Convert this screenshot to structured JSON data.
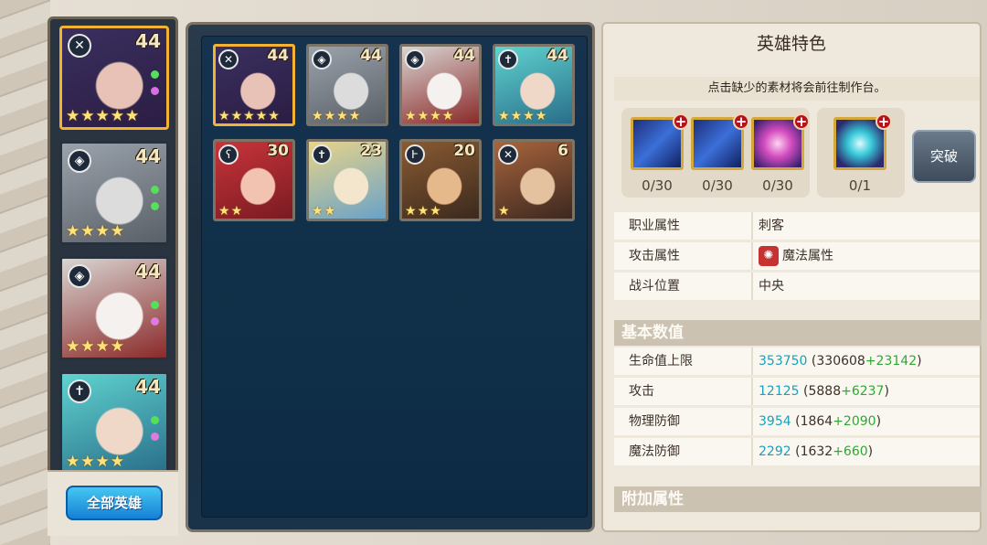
{
  "left_list": {
    "heroes": [
      {
        "level": "44",
        "stars": 5,
        "class_icon": "assassin-icon",
        "selected": true,
        "palette": [
          "#3a2f5e",
          "#e8c2b6",
          "#2b1d44"
        ],
        "gems": [
          "#55e05a",
          "#d86fe0"
        ]
      },
      {
        "level": "44",
        "stars": 4,
        "class_icon": "shield-icon",
        "selected": false,
        "palette": [
          "#9aa2ab",
          "#dcdcdc",
          "#5a6068"
        ],
        "gems": [
          "#55e05a",
          "#55e05a"
        ]
      },
      {
        "level": "44",
        "stars": 4,
        "class_icon": "shield-icon",
        "selected": false,
        "palette": [
          "#d8d5d2",
          "#f4f1ee",
          "#8b2a2a"
        ],
        "gems": [
          "#55e05a",
          "#e07ae0"
        ]
      },
      {
        "level": "44",
        "stars": 4,
        "class_icon": "cross-icon",
        "selected": false,
        "palette": [
          "#5fd3cf",
          "#f0d8c8",
          "#2a6e8a"
        ],
        "gems": [
          "#55e05a",
          "#e07ae0"
        ]
      }
    ],
    "all_heroes_label": "全部英雄"
  },
  "grid": {
    "heroes": [
      {
        "level": "44",
        "stars": 5,
        "class_icon": "assassin-icon",
        "selected": true,
        "palette": [
          "#3a2f5e",
          "#e8c2b6",
          "#2b1d44"
        ]
      },
      {
        "level": "44",
        "stars": 4,
        "class_icon": "shield-icon",
        "selected": false,
        "palette": [
          "#9aa2ab",
          "#dcdcdc",
          "#5a6068"
        ]
      },
      {
        "level": "44",
        "stars": 4,
        "class_icon": "shield-icon",
        "selected": false,
        "palette": [
          "#d8d5d2",
          "#f4f1ee",
          "#8b2a2a"
        ]
      },
      {
        "level": "44",
        "stars": 4,
        "class_icon": "cross-icon",
        "selected": false,
        "palette": [
          "#5fd3cf",
          "#f0d8c8",
          "#2a6e8a"
        ]
      },
      {
        "level": "30",
        "stars": 2,
        "class_icon": "staff-icon",
        "selected": false,
        "palette": [
          "#c8343a",
          "#f2c3b0",
          "#7a1b22"
        ]
      },
      {
        "level": "23",
        "stars": 2,
        "class_icon": "cross-icon",
        "selected": false,
        "palette": [
          "#e8d488",
          "#f4e6cc",
          "#6aa2c8"
        ]
      },
      {
        "level": "20",
        "stars": 3,
        "class_icon": "axe-icon",
        "selected": false,
        "palette": [
          "#8a5a32",
          "#e6b98c",
          "#3b2a1e"
        ]
      },
      {
        "level": "6",
        "stars": 1,
        "class_icon": "assassin-icon",
        "selected": false,
        "palette": [
          "#a8643c",
          "#e4c2a0",
          "#3c2820"
        ]
      }
    ]
  },
  "right_panel": {
    "title": "英雄特色",
    "hint": "点击缺少的素材将会前往制作台。",
    "materials": [
      {
        "count": "0/30",
        "icon": "blue-crystal-icon"
      },
      {
        "count": "0/30",
        "icon": "blue-crystal-icon"
      },
      {
        "count": "0/30",
        "icon": "pink-spark-icon"
      },
      {
        "count": "0/1",
        "icon": "star-gem-icon"
      }
    ],
    "break_label": "突破",
    "attributes": [
      {
        "key": "职业属性",
        "value": "刺客"
      },
      {
        "key": "攻击属性",
        "value": "魔法属性"
      },
      {
        "key": "战斗位置",
        "value": "中央"
      }
    ],
    "basic_section": "基本数值",
    "stats": [
      {
        "key": "生命值上限",
        "total": "353750",
        "base": "330608",
        "bonus": "+23142"
      },
      {
        "key": "攻击",
        "total": "12125",
        "base": "5888",
        "bonus": "+6237"
      },
      {
        "key": "物理防御",
        "total": "3954",
        "base": "1864",
        "bonus": "+2090"
      },
      {
        "key": "魔法防御",
        "total": "2292",
        "base": "1632",
        "bonus": "+660"
      }
    ],
    "extra_section": "附加属性"
  }
}
